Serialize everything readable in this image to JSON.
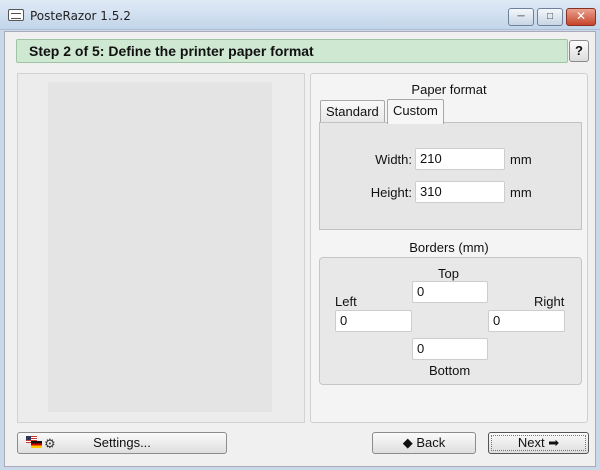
{
  "window": {
    "title": "PosteRazor 1.5.2",
    "minimize_glyph": "─",
    "maximize_glyph": "□",
    "close_glyph": "✕"
  },
  "header": {
    "step_title": "Step 2 of 5: Define the printer paper format",
    "help_label": "?"
  },
  "paper_format": {
    "title": "Paper format",
    "tabs": [
      {
        "label": "Standard",
        "selected": false
      },
      {
        "label": "Custom",
        "selected": true
      }
    ],
    "width_label": "Width:",
    "width_value": "210",
    "width_unit": "mm",
    "height_label": "Height:",
    "height_value": "310",
    "height_unit": "mm"
  },
  "borders": {
    "title": "Borders (mm)",
    "top_label": "Top",
    "top_value": "0",
    "left_label": "Left",
    "left_value": "0",
    "right_label": "Right",
    "right_value": "0",
    "bottom_label": "Bottom",
    "bottom_value": "0"
  },
  "footer": {
    "settings_label": "Settings...",
    "back_label": "◆ Back",
    "next_label": "Next ➡"
  },
  "icons": {
    "app": "poster-icon",
    "settings": "language-flags-and-tools-icon",
    "back": "left-arrow-icon",
    "next": "right-arrow-icon"
  },
  "colors": {
    "header_bg": "#cfe8d2",
    "titlebar_bg": "#c3d5ea",
    "close_button": "#c8432a"
  }
}
